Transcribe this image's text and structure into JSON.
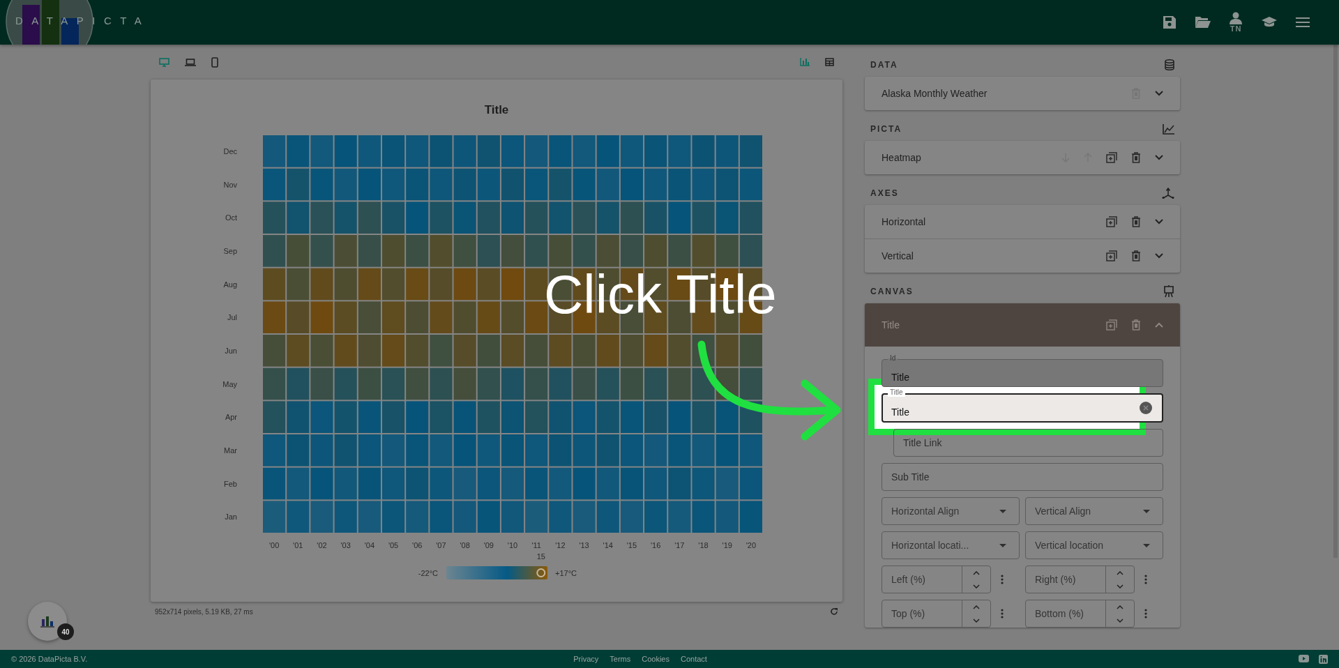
{
  "app": {
    "logo": "DATAPICTA",
    "user_initials": "TN"
  },
  "preview": {
    "devices": [
      {
        "kind": "desktop",
        "selected": true
      },
      {
        "kind": "laptop",
        "selected": false
      },
      {
        "kind": "phone",
        "selected": false
      }
    ],
    "views": [
      {
        "kind": "chart",
        "selected": true
      },
      {
        "kind": "table",
        "selected": false
      }
    ],
    "title": "Title",
    "rows": [
      "Dec",
      "Nov",
      "Oct",
      "Sep",
      "Aug",
      "Jul",
      "Jun",
      "May",
      "Apr",
      "Mar",
      "Feb",
      "Jan"
    ],
    "columns": [
      "'00",
      "'01",
      "'02",
      "'03",
      "'04",
      "'05",
      "'06",
      "'07",
      "'08",
      "'09",
      "'10",
      "'11",
      "'12",
      "'13",
      "'14",
      "'15",
      "'16",
      "'17",
      "'18",
      "'19",
      "'20"
    ],
    "legend": {
      "min": "-22°C",
      "max": "+17°C",
      "marker": "15",
      "level": 0.95
    },
    "status": "952x714 pixels, 5.19 KB, 27 ms"
  },
  "panel": {
    "sections": [
      {
        "heading": "DATA",
        "items": [
          {
            "label": "Alaska Monthly Weather",
            "expanded": false,
            "actions": [
              {
                "kind": "delete",
                "disabled": true
              }
            ]
          }
        ]
      },
      {
        "heading": "PICTA",
        "items": [
          {
            "label": "Heatmap",
            "expanded": false,
            "actions": [
              {
                "kind": "down",
                "disabled": true
              },
              {
                "kind": "up",
                "disabled": true
              },
              {
                "kind": "duplicate",
                "disabled": false
              },
              {
                "kind": "delete",
                "disabled": false
              }
            ]
          }
        ]
      },
      {
        "heading": "AXES",
        "items": [
          {
            "label": "Horizontal",
            "expanded": false,
            "actions": [
              {
                "kind": "duplicate",
                "disabled": false
              },
              {
                "kind": "delete",
                "disabled": false
              }
            ]
          },
          {
            "label": "Vertical",
            "expanded": false,
            "actions": [
              {
                "kind": "duplicate",
                "disabled": false
              },
              {
                "kind": "delete",
                "disabled": false
              }
            ]
          }
        ]
      },
      {
        "heading": "CANVAS",
        "items": [
          {
            "label": "Title",
            "expanded": true,
            "actions": [
              {
                "kind": "duplicate",
                "disabled": false
              },
              {
                "kind": "delete",
                "disabled": false
              }
            ],
            "fields": [
              {
                "kind": "text",
                "label": "Id",
                "value": "Title",
                "disabled": true,
                "focused": false
              },
              {
                "kind": "text",
                "label": "Title",
                "value": "Title",
                "disabled": false,
                "focused": true
              },
              {
                "kind": "subtext",
                "placeholder": "Title Link"
              },
              {
                "kind": "wide",
                "placeholder": "Sub Title"
              },
              {
                "kind": "select",
                "placeholder": "Horizontal Align"
              },
              {
                "kind": "select",
                "placeholder": "Vertical Align"
              },
              {
                "kind": "select",
                "placeholder": "Horizontal locati..."
              },
              {
                "kind": "select",
                "placeholder": "Vertical location"
              },
              {
                "kind": "spinner",
                "placeholder": "Left (%)"
              },
              {
                "kind": "spinner",
                "placeholder": "Right (%)"
              },
              {
                "kind": "spinner",
                "placeholder": "Top (%)"
              },
              {
                "kind": "spinner",
                "placeholder": "Bottom (%)"
              }
            ]
          }
        ]
      }
    ]
  },
  "badge": "40",
  "annotation": {
    "text": "Click Title"
  },
  "footer": {
    "copyright": "© 2026 DataPicta B.V.",
    "links": [
      "Privacy",
      "Terms",
      "Cookies",
      "Contact"
    ]
  }
}
